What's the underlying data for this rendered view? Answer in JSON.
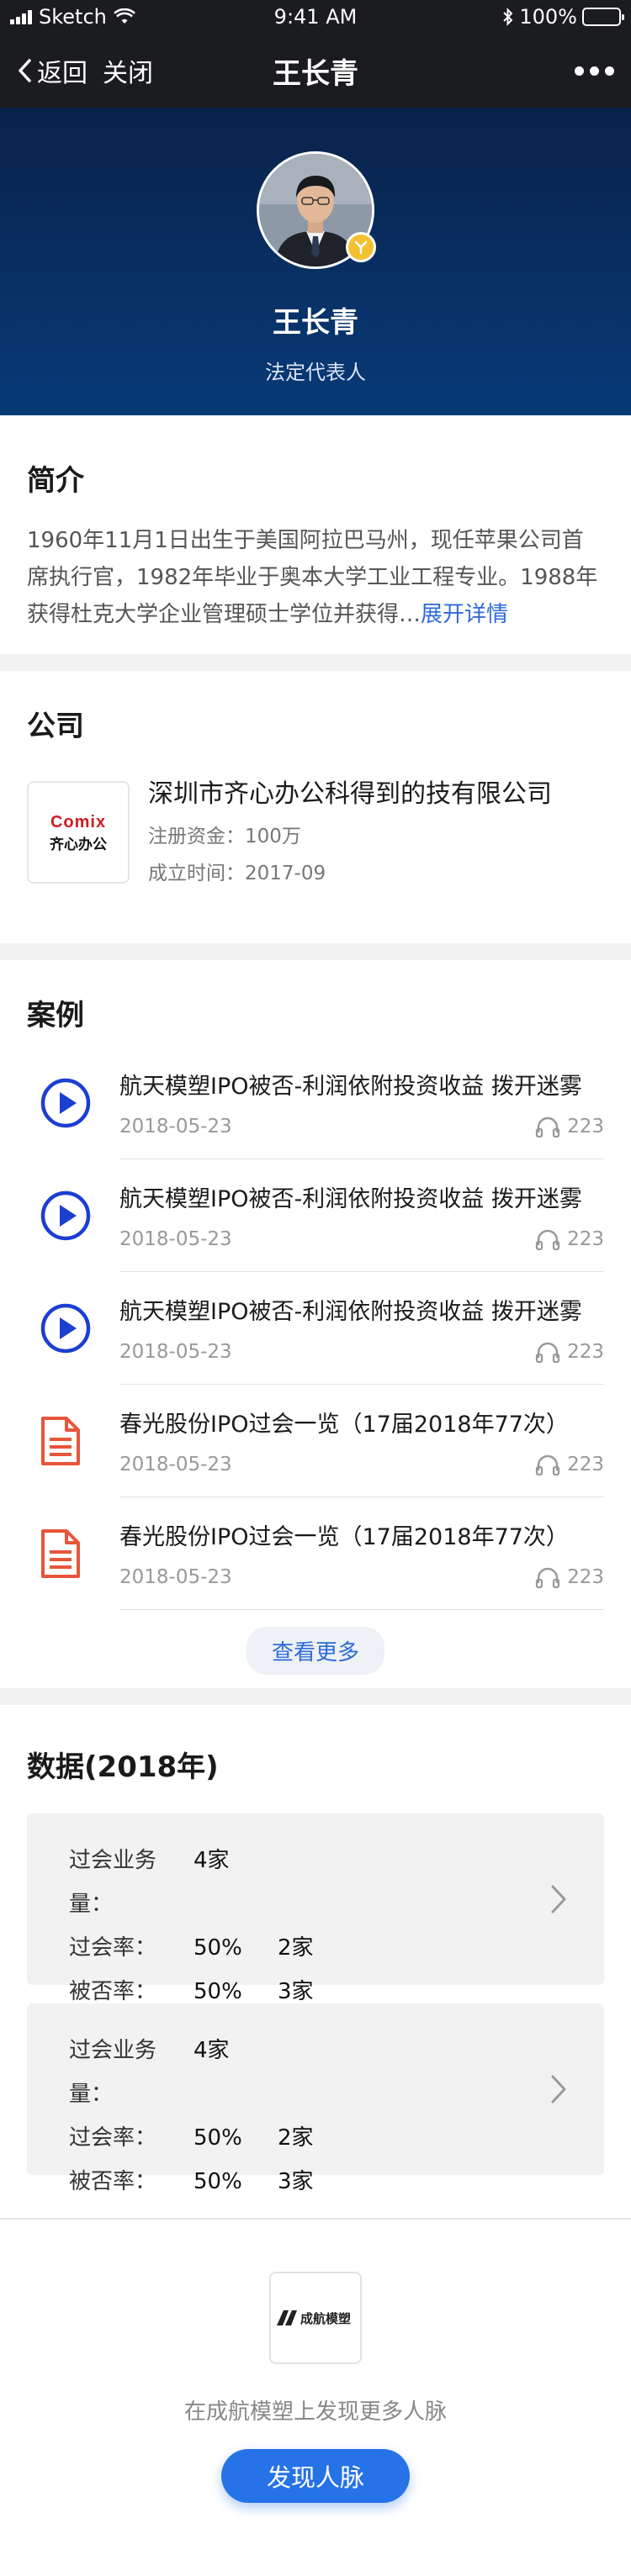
{
  "status_bar": {
    "carrier": "Sketch",
    "time": "9:41 AM",
    "battery": "100%",
    "battery_level": 1.0
  },
  "nav": {
    "back_label": "返回",
    "close_label": "关闭",
    "title": "王长青"
  },
  "profile": {
    "name": "王长青",
    "role": "法定代表人"
  },
  "intro": {
    "title": "简介",
    "text": "1960年11月1日出生于美国阿拉巴马州，现任苹果公司首席执行官，1982年毕业于奥本大学工业工程专业。1988年获得杜克大学企业管理硕士学位并获得…",
    "more_label": "展开详情"
  },
  "company": {
    "title": "公司",
    "name": "深圳市齐心办公科得到的技有限公司",
    "capital": "注册资金：100万",
    "founded": "成立时间：2017-09",
    "logo_top": "Comix",
    "logo_bottom": "齐心办公"
  },
  "cases": {
    "title": "案例",
    "items": [
      {
        "type": "audio",
        "title": "航天模塑IPO被否-利润依附投资收益 拨开迷雾",
        "date": "2018-05-23",
        "plays": "223"
      },
      {
        "type": "audio",
        "title": "航天模塑IPO被否-利润依附投资收益 拨开迷雾",
        "date": "2018-05-23",
        "plays": "223"
      },
      {
        "type": "audio",
        "title": "航天模塑IPO被否-利润依附投资收益 拨开迷雾",
        "date": "2018-05-23",
        "plays": "223"
      },
      {
        "type": "document",
        "title": "春光股份IPO过会一览（17届2018年77次）",
        "date": "2018-05-23",
        "plays": "223"
      },
      {
        "type": "document",
        "title": "春光股份IPO过会一览（17届2018年77次）",
        "date": "2018-05-23",
        "plays": "223"
      }
    ],
    "view_more_label": "查看更多"
  },
  "data": {
    "title": "数据(2018年)",
    "cards": [
      {
        "volume_label": "过会业务量：",
        "volume_value": "4家",
        "pass_label": "过会率：",
        "pass_rate": "50%",
        "pass_count": "2家",
        "reject_label": "被否率：",
        "reject_rate": "50%",
        "reject_count": "3家"
      },
      {
        "volume_label": "过会业务量：",
        "volume_value": "4家",
        "pass_label": "过会率：",
        "pass_rate": "50%",
        "pass_count": "2家",
        "reject_label": "被否率：",
        "reject_rate": "50%",
        "reject_count": "3家"
      }
    ]
  },
  "footer": {
    "logo_text": "成航模塑",
    "text": "在成航模塑上发现更多人脉",
    "button_label": "发现人脉"
  },
  "colors": {
    "accent_blue": "#2673e8",
    "link_blue": "#2e6bd6",
    "audio_icon": "#1b3fd0",
    "doc_icon": "#e8553a",
    "hero_top": "#09224a",
    "hero_bottom": "#083a78",
    "verified_badge": "#f3c12f"
  },
  "icons": {
    "back": "chevron-left-icon",
    "more": "more-dots-icon",
    "audio": "play-circle-icon",
    "document": "document-icon",
    "plays": "headphones-icon",
    "chevron": "chevron-right-icon",
    "verified": "verified-badge-icon"
  }
}
